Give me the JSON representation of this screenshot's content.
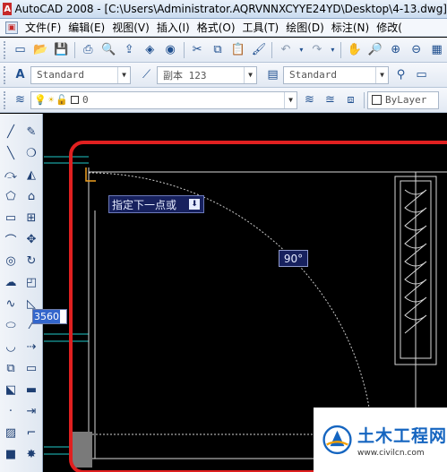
{
  "window": {
    "title": "AutoCAD 2008 - [C:\\Users\\Administrator.AQRVNNXCYYE24YD\\Desktop\\4-13.dwg]"
  },
  "menu": {
    "items": [
      "文件(F)",
      "编辑(E)",
      "视图(V)",
      "插入(I)",
      "格式(O)",
      "工具(T)",
      "绘图(D)",
      "标注(N)",
      "修改("
    ]
  },
  "styles_toolbar": {
    "text_style": "Standard",
    "dim_style": "副本 123",
    "table_style": "Standard"
  },
  "layers_toolbar": {
    "layer_name": "0",
    "color": "ByLayer"
  },
  "canvas": {
    "prompt_tooltip": "指定下一点或",
    "angle_label": "90°",
    "dimension_input": "3560"
  },
  "watermark": {
    "title": "土木工程网",
    "url": "www.civilcn.com"
  },
  "colors": {
    "highlight_red": "#e02020",
    "tooltip_bg": "#17215e"
  }
}
